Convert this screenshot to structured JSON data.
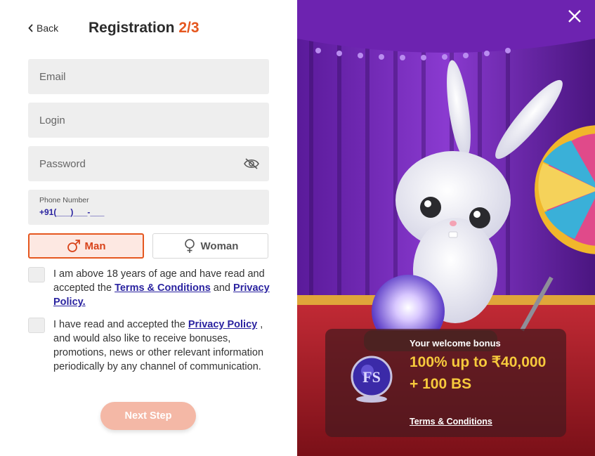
{
  "header": {
    "back_label": "Back",
    "title": "Registration",
    "step": "2/3"
  },
  "form": {
    "email_placeholder": "Email",
    "login_placeholder": "Login",
    "password_placeholder": "Password",
    "phone_label": "Phone Number",
    "phone_value": "+91(___)___-___"
  },
  "gender": {
    "man_label": "Man",
    "woman_label": "Woman",
    "selected": "Man"
  },
  "consent": {
    "age_text": "I am above 18 years of age and have read and accepted the",
    "age_link1": "Terms & Conditions",
    "age_and": "and",
    "age_link2": "Privacy Policy.",
    "promo_text1": "I have read and accepted the",
    "promo_link": "Privacy Policy",
    "promo_text2": ", and would also like to receive bonuses, promotions, news or other relevant information periodically by any channel of communication."
  },
  "next_button_label": "Next Step",
  "bonus": {
    "label": "Your welcome bonus",
    "amount": "100% up to ₹40,000 + 100 BS",
    "terms_link": "Terms & Conditions",
    "logo_icon": "fs-crystal-ball-logo"
  },
  "colors": {
    "accent": "#e5571f",
    "link": "#2a23a0",
    "bonus_text": "#f6c93c",
    "button_disabled": "#f4b8a6"
  }
}
